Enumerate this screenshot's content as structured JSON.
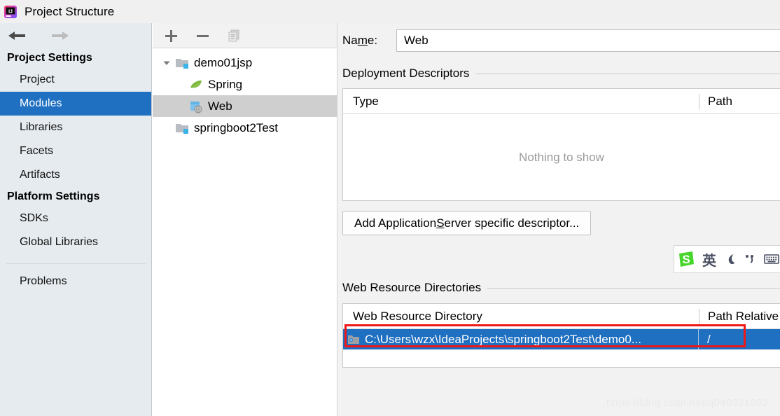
{
  "window": {
    "title": "Project Structure",
    "logo_icon": "intellij-idea-logo"
  },
  "nav": {
    "back_icon": "arrow-left-icon",
    "forward_icon": "arrow-right-icon"
  },
  "sidebar": {
    "groups": [
      {
        "label": "Project Settings",
        "items": [
          {
            "label": "Project",
            "selected": false
          },
          {
            "label": "Modules",
            "selected": true
          },
          {
            "label": "Libraries",
            "selected": false
          },
          {
            "label": "Facets",
            "selected": false
          },
          {
            "label": "Artifacts",
            "selected": false
          }
        ]
      },
      {
        "label": "Platform Settings",
        "items": [
          {
            "label": "SDKs",
            "selected": false
          },
          {
            "label": "Global Libraries",
            "selected": false
          }
        ]
      }
    ],
    "problems_label": "Problems",
    "selected_color": "#1f70c1"
  },
  "tree_panel": {
    "toolbar": [
      {
        "name": "add-button",
        "icon": "plus-icon",
        "enabled": true
      },
      {
        "name": "remove-button",
        "icon": "minus-icon",
        "enabled": true
      },
      {
        "name": "copy-button",
        "icon": "copy-icon",
        "enabled": false
      }
    ],
    "rows": [
      {
        "label": "demo01jsp",
        "icon": "module-folder-icon",
        "level": 0,
        "expanded": true,
        "selected": false
      },
      {
        "label": "Spring",
        "icon": "spring-leaf-icon",
        "level": 1,
        "selected": false
      },
      {
        "label": "Web",
        "icon": "web-facet-icon",
        "level": 1,
        "selected": true
      },
      {
        "label": "springboot2Test",
        "icon": "module-folder-icon",
        "level": 0,
        "selected": false
      }
    ]
  },
  "content": {
    "name_label_pre": "Na",
    "name_label_mnemonic": "m",
    "name_label_post": "e:",
    "name_value": "Web",
    "name_placeholder": "",
    "deployment": {
      "section_title": "Deployment Descriptors",
      "columns": [
        "Type",
        "Path"
      ],
      "empty_text": "Nothing to show",
      "add_button_pre": "Add Application ",
      "add_button_mnemonic": "S",
      "add_button_post": "erver specific descriptor..."
    },
    "web_resources": {
      "section_title": "Web Resource Directories",
      "columns": [
        "Web Resource Directory",
        "Path Relative"
      ],
      "rows": [
        {
          "directory": "C:\\Users\\wzx\\IdeaProjects\\springboot2Test\\demo0...",
          "path_relative": "/",
          "icon": "folder-icon",
          "selected": true,
          "highlighted": true
        }
      ],
      "highlight_color": "#f01717"
    }
  },
  "ime": {
    "logo_icon": "sogou-logo-icon",
    "mode_label": "英",
    "moon_icon": "moon-icon",
    "punctuation_icon": "punctuation-icon",
    "keyboard_icon": "keyboard-icon",
    "user_icon": "user-icon"
  },
  "watermark": {
    "text": "https://blog.csdn.net/q040321092"
  }
}
